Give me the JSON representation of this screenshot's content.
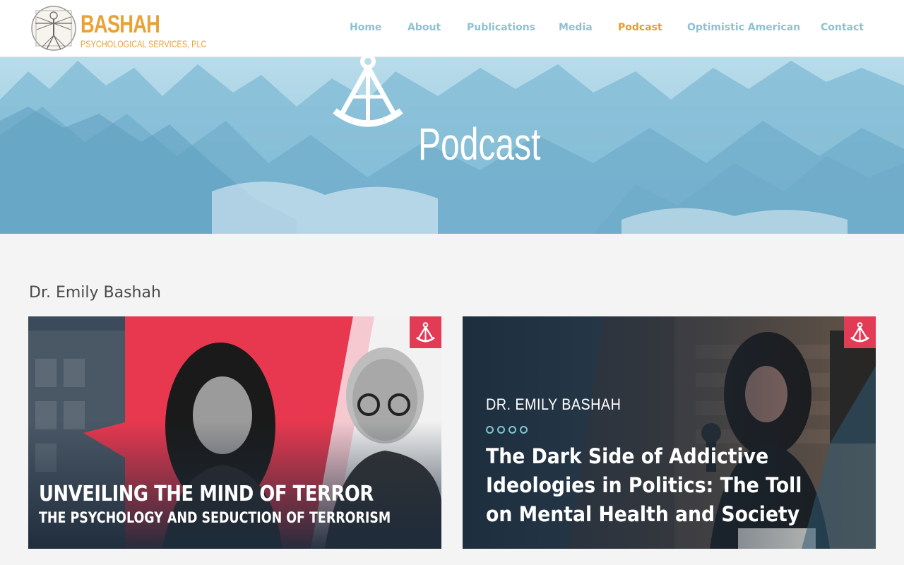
{
  "brand": {
    "name": "BASHAH",
    "subtitle": "PSYCHOLOGICAL SERVICES, PLC",
    "color": "#e8a236"
  },
  "nav": {
    "items": [
      {
        "label": "Home",
        "active": false
      },
      {
        "label": "About",
        "active": false
      },
      {
        "label": "Publications",
        "active": false
      },
      {
        "label": "Media",
        "active": false
      },
      {
        "label": "Podcast",
        "active": true
      },
      {
        "label": "Optimistic American",
        "active": false
      },
      {
        "label": "Contact",
        "active": false
      }
    ],
    "color": "#8cc3d2",
    "active_color": "#e3a02d"
  },
  "hero": {
    "title": "Podcast",
    "icon": "sextant-icon"
  },
  "section": {
    "heading": "Dr. Emily Bashah"
  },
  "cards": [
    {
      "title": "UNVEILING THE MIND OF TERROR",
      "subtitle": "THE PSYCHOLOGY AND SEDUCTION OF TERRORISM",
      "badge_icon": "sextant-icon",
      "accent": "#e23b55"
    },
    {
      "host": "DR. EMILY BASHAH",
      "title": "The Dark Side of Addictive Ideologies in Politics: The Toll on Mental Health and Society",
      "badge_icon": "sextant-icon",
      "accent": "#e23b55"
    }
  ]
}
